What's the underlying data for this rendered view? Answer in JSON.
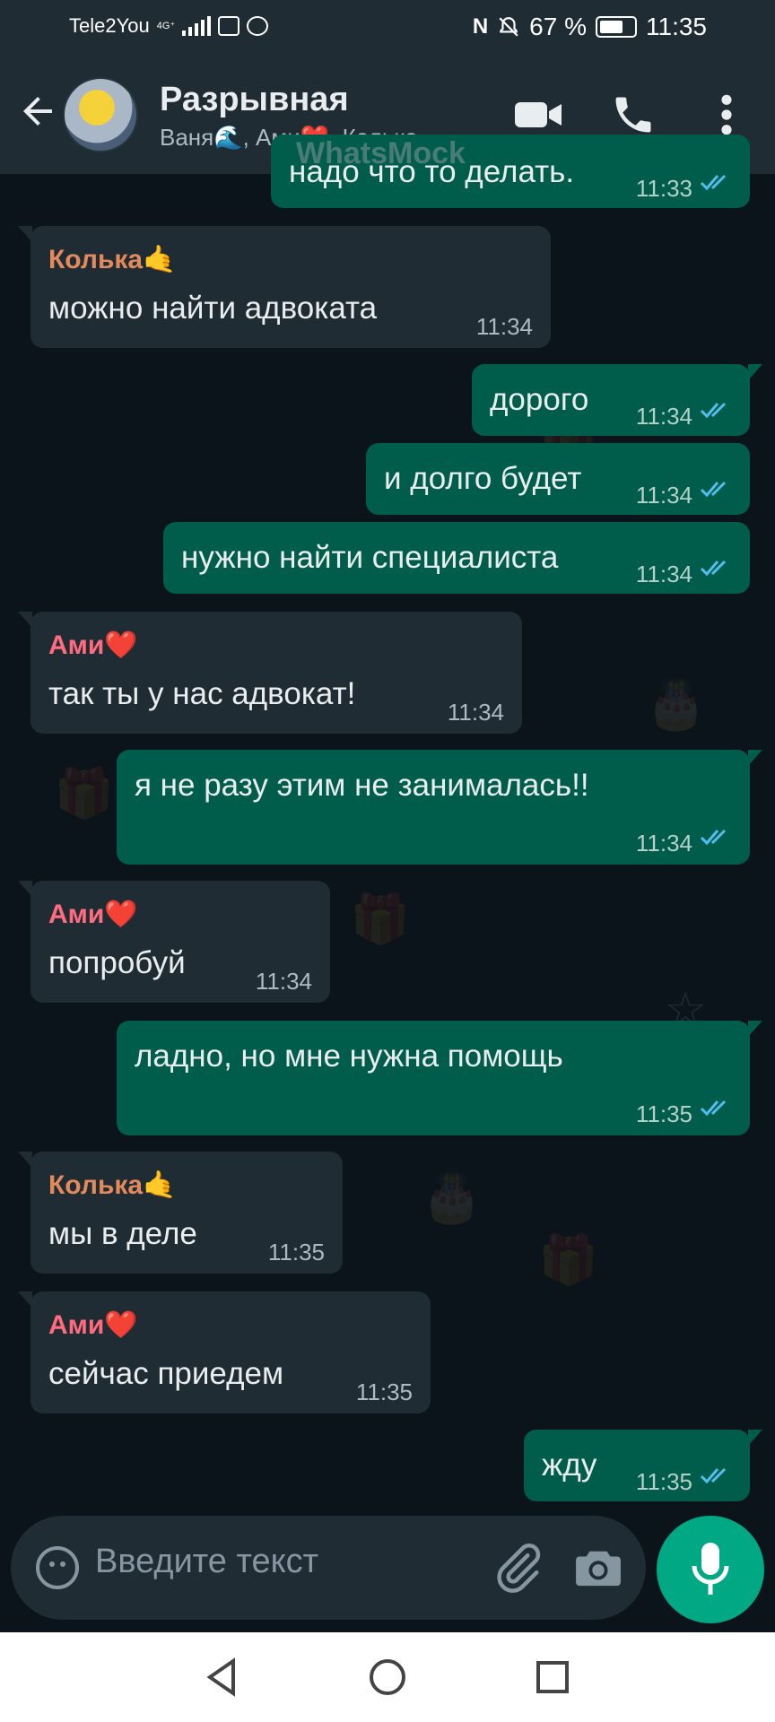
{
  "status_bar": {
    "carrier": "Tele2You",
    "network": "4G⁺",
    "battery": "67 %",
    "time": "11:35",
    "colors": {
      "background": "#1f2c34"
    }
  },
  "header": {
    "title": "Разрывная",
    "subtitle": "Ваня🌊, Ами❤️, Колька..",
    "watermark": "WhatsMock",
    "icons": [
      "back-arrow-icon",
      "video-call-icon",
      "phone-icon",
      "more-vert-icon"
    ]
  },
  "messages": [
    {
      "direction": "out",
      "text": "надо что то делать.",
      "time": "11:33",
      "read": true
    },
    {
      "direction": "in",
      "sender": "Колька🤙",
      "sender_color": "#e28a5b",
      "text": "можно найти адвоката",
      "time": "11:34"
    },
    {
      "direction": "out",
      "text": "дорого",
      "time": "11:34",
      "read": true
    },
    {
      "direction": "out",
      "text": "и долго будет",
      "time": "11:34",
      "read": true
    },
    {
      "direction": "out",
      "text": "нужно найти специалиста",
      "time": "11:34",
      "read": true
    },
    {
      "direction": "in",
      "sender": "Ами❤️",
      "sender_color": "#ff6b7f",
      "text": "так ты у нас адвокат!",
      "time": "11:34"
    },
    {
      "direction": "out",
      "text": "я не разу этим не занималась!!",
      "time": "11:34",
      "read": true
    },
    {
      "direction": "in",
      "sender": "Ами❤️",
      "sender_color": "#ff6b7f",
      "text": "попробуй",
      "time": "11:34"
    },
    {
      "direction": "out",
      "text": "ладно, но мне нужна помощь",
      "time": "11:35",
      "read": true
    },
    {
      "direction": "in",
      "sender": "Колька🤙",
      "sender_color": "#e28a5b",
      "text": "мы в деле",
      "time": "11:35"
    },
    {
      "direction": "in",
      "sender": "Ами❤️",
      "sender_color": "#ff6b7f",
      "text": "сейчас приедем",
      "time": "11:35"
    },
    {
      "direction": "out",
      "text": "жду",
      "time": "11:35",
      "read": true
    }
  ],
  "composer": {
    "placeholder": "Введите текст",
    "icons": [
      "emoji-icon",
      "attach-icon",
      "camera-icon",
      "mic-icon"
    ]
  },
  "colors": {
    "wallpaper": "#0b141a",
    "incoming_bubble": "#202c33",
    "outgoing_bubble": "#005c4b",
    "read_ticks": "#53bdeb",
    "mic_button": "#00a884"
  },
  "nav_bar": {
    "icons": [
      "nav-back-icon",
      "nav-home-icon",
      "nav-recent-icon"
    ]
  }
}
